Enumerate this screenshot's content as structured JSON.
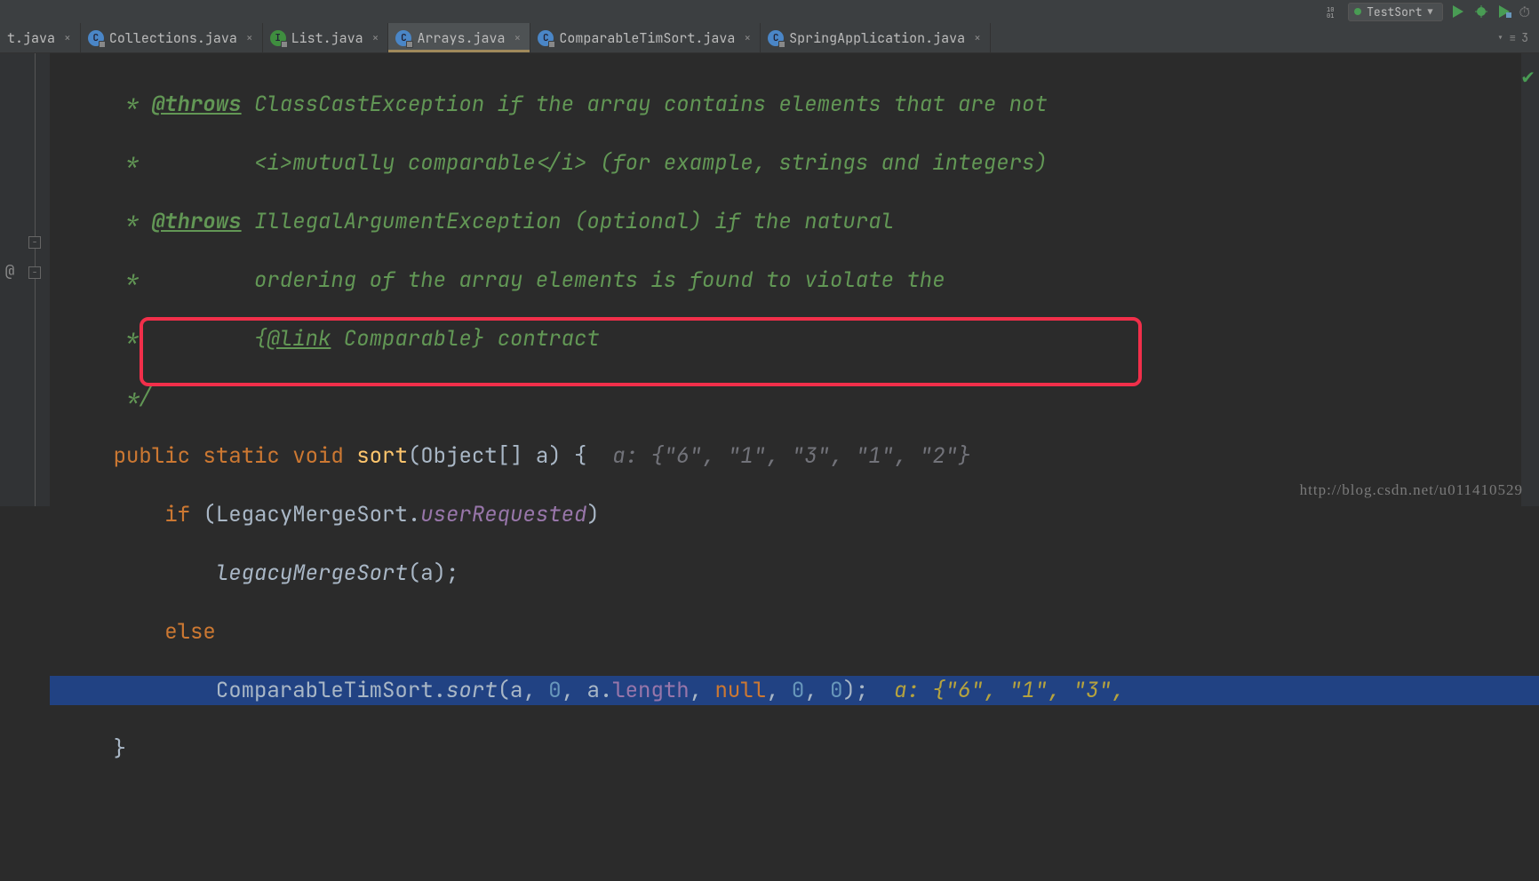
{
  "toolbar": {
    "run_config_label": "TestSort",
    "binary_label": "10\n01"
  },
  "tabs": [
    {
      "label": "t.java",
      "icon": "class",
      "letter": "C",
      "active": false,
      "partial": true
    },
    {
      "label": "Collections.java",
      "icon": "class",
      "letter": "C",
      "active": false
    },
    {
      "label": "List.java",
      "icon": "interface",
      "letter": "I",
      "active": false
    },
    {
      "label": "Arrays.java",
      "icon": "class",
      "letter": "C",
      "active": true
    },
    {
      "label": "ComparableTimSort.java",
      "icon": "class",
      "letter": "C",
      "active": false
    },
    {
      "label": "SpringApplication.java",
      "icon": "class",
      "letter": "C",
      "active": false
    }
  ],
  "tab_tools": {
    "count": "3"
  },
  "code": {
    "l1_a": "     * ",
    "l1_tag": "@throws",
    "l1_b": " ClassCastException if the array contains elements that are not",
    "l2_a": "     *         ",
    "l2_b": "<i>mutually comparable</i> (for example, strings and integers)",
    "l3_a": "     * ",
    "l3_tag": "@throws",
    "l3_b": " IllegalArgumentException (optional) if the natural",
    "l4_a": "     *         ",
    "l4_b": "ordering of the array elements is found to violate the",
    "l5_a": "     *         {",
    "l5_link": "@link",
    "l5_b": " Comparable} contract",
    "l6": "     */",
    "l7_indent": "    ",
    "l7_kw1": "public",
    "l7_kw2": "static",
    "l7_kw3": "void",
    "l7_method": "sort",
    "l7_sig_a": "(Object[] a) {  ",
    "l7_hint": "a: {\"6\", \"1\", \"3\", \"1\", \"2\"}",
    "l8_indent": "        ",
    "l8_kw": "if",
    "l8_a": " (LegacyMergeSort.",
    "l8_field": "userRequested",
    "l8_b": ")",
    "l9_indent": "            ",
    "l9_m": "legacyMergeSort",
    "l9_b": "(a);",
    "l10_indent": "        ",
    "l10_kw": "else",
    "l11_indent": "            ",
    "l11_a": "ComparableTimSort.",
    "l11_m": "sort",
    "l11_b": "(a, ",
    "l11_n0": "0",
    "l11_c1": ", a.",
    "l11_len": "length",
    "l11_c2": ", ",
    "l11_null": "null",
    "l11_c3": ", ",
    "l11_n0b": "0",
    "l11_c4": ", ",
    "l11_n0c": "0",
    "l11_c5": ");  ",
    "l11_hint": "a: {\"6\", \"1\", \"3\",",
    "l12_indent": "    ",
    "l12": "}"
  },
  "watermark": "http://blog.csdn.net/u011410529"
}
